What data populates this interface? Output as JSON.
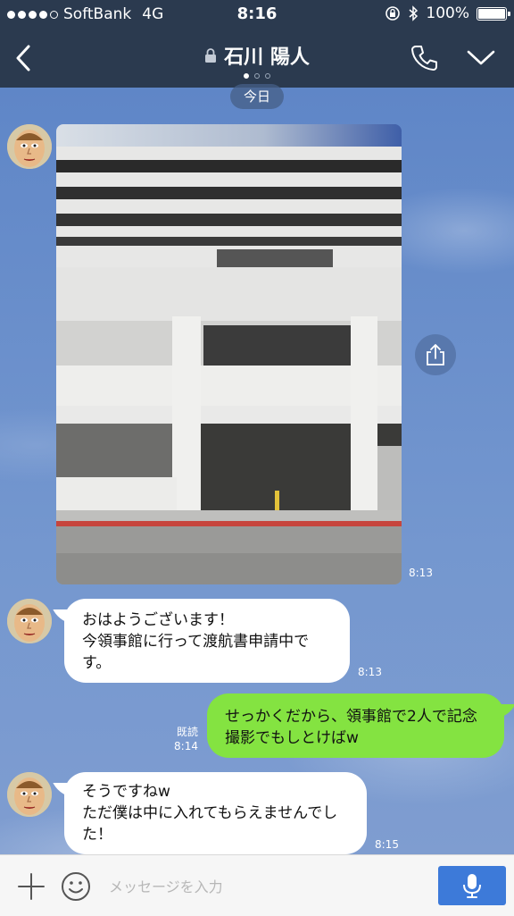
{
  "status_bar": {
    "carrier": "SoftBank",
    "network": "4G",
    "time": "8:16",
    "battery_percent": "100%",
    "battery_level": 1.0,
    "signal_bars_filled": 4,
    "signal_bars_total": 5
  },
  "header": {
    "contact_name": "石川 陽人",
    "page_dots_total": 3,
    "page_dot_active": 0
  },
  "chat": {
    "date_divider": "今日",
    "messages": [
      {
        "direction": "in",
        "type": "image",
        "time": "8:13"
      },
      {
        "direction": "in",
        "type": "text",
        "text": "おはようございます！\n今領事館に行って渡航書申請中です。",
        "time": "8:13"
      },
      {
        "direction": "out",
        "type": "text",
        "text": "せっかくだから、領事館で2人で記念撮影でもしとけばw",
        "time": "8:14",
        "read_label": "既読"
      },
      {
        "direction": "in",
        "type": "text",
        "text": "そうですねw\nただ僕は中に入れてもらえませんでした！",
        "time": "8:15"
      }
    ]
  },
  "input_bar": {
    "placeholder": "メッセージを入力"
  },
  "colors": {
    "header_bg": "#2b3a4f",
    "outgoing_bubble": "#84e341",
    "incoming_bubble": "#ffffff",
    "mic_button": "#3d7ad9"
  },
  "icons": {
    "back": "chevron-left-icon",
    "lock": "lock-icon",
    "phone": "phone-icon",
    "menu": "chevron-down-icon",
    "share": "share-icon",
    "plus": "plus-icon",
    "emoji": "smiley-icon",
    "mic": "microphone-icon"
  }
}
